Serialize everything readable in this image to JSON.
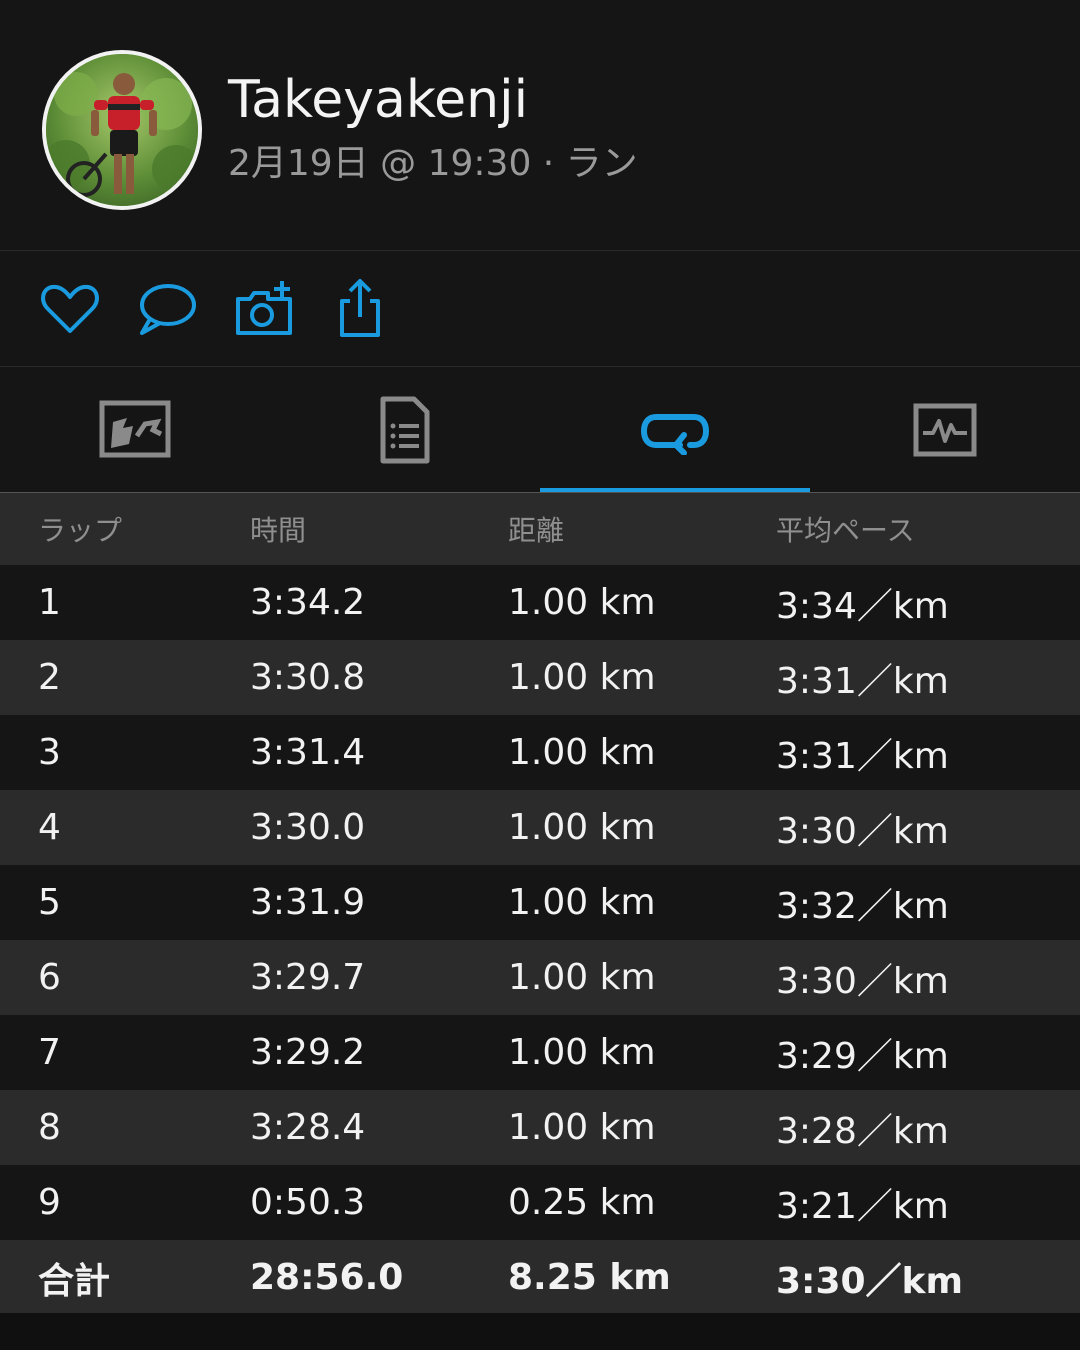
{
  "colors": {
    "accent": "#1a9be0",
    "background": "#151515",
    "row_alt": "#2b2b2b",
    "muted_text": "#9a9a9a"
  },
  "profile": {
    "username": "Takeyakenji",
    "meta": "2月19日 @ 19:30 · ラン"
  },
  "actions": [
    {
      "icon": "heart-icon"
    },
    {
      "icon": "comment-icon"
    },
    {
      "icon": "add-photo-icon"
    },
    {
      "icon": "share-icon"
    }
  ],
  "tabs": [
    {
      "icon": "map-icon",
      "active": false
    },
    {
      "icon": "details-document-icon",
      "active": false
    },
    {
      "icon": "laps-loop-icon",
      "active": true
    },
    {
      "icon": "chart-icon",
      "active": false
    }
  ],
  "laps_table": {
    "headers": [
      "ラップ",
      "時間",
      "距離",
      "平均ペース"
    ],
    "rows": [
      [
        "1",
        "3:34.2",
        "1.00 km",
        "3:34／km"
      ],
      [
        "2",
        "3:30.8",
        "1.00 km",
        "3:31／km"
      ],
      [
        "3",
        "3:31.4",
        "1.00 km",
        "3:31／km"
      ],
      [
        "4",
        "3:30.0",
        "1.00 km",
        "3:30／km"
      ],
      [
        "5",
        "3:31.9",
        "1.00 km",
        "3:32／km"
      ],
      [
        "6",
        "3:29.7",
        "1.00 km",
        "3:30／km"
      ],
      [
        "7",
        "3:29.2",
        "1.00 km",
        "3:29／km"
      ],
      [
        "8",
        "3:28.4",
        "1.00 km",
        "3:28／km"
      ],
      [
        "9",
        "0:50.3",
        "0.25 km",
        "3:21／km"
      ]
    ],
    "total": [
      "合計",
      "28:56.0",
      "8.25 km",
      "3:30／km"
    ]
  }
}
